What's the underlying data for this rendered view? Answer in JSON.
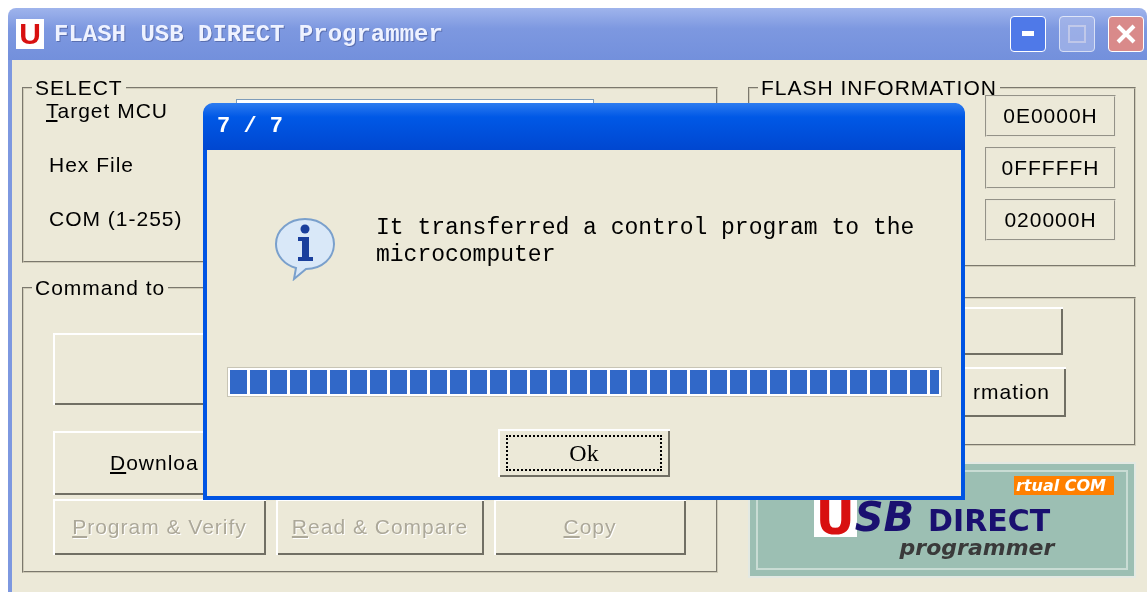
{
  "window": {
    "icon_letter": "U",
    "title": "FLASH USB DIRECT Programmer",
    "controls": [
      {
        "kind": "minimize",
        "disabled": false
      },
      {
        "kind": "maximize",
        "disabled": true
      },
      {
        "kind": "close",
        "disabled": false
      }
    ]
  },
  "select": {
    "legend": "SELECT",
    "rows": [
      {
        "label": "Target MCU",
        "mnemonic": true
      },
      {
        "label": "Hex File",
        "mnemonic": false
      },
      {
        "label": "COM (1-255)",
        "mnemonic": false
      }
    ]
  },
  "command": {
    "legend": "Command to",
    "buttons": [
      {
        "kind": "blank"
      },
      {
        "kind": "text",
        "label": "Downloa",
        "mnemonic": true
      }
    ],
    "bottom_buttons": [
      {
        "label": "Program & Verify",
        "mnemonic": true,
        "disabled": true
      },
      {
        "label": "Read & Compare",
        "mnemonic": true,
        "disabled": true
      },
      {
        "label": "Copy",
        "mnemonic": true,
        "disabled": true
      }
    ]
  },
  "flash_information": {
    "legend": "FLASH INFORMATION",
    "values": [
      "0E0000H",
      "0FFFFFH",
      "020000H"
    ]
  },
  "side_buttons": [
    {
      "kind": "blank"
    },
    {
      "kind": "text",
      "label": "rmation"
    }
  ],
  "logo": {
    "badge": "rtual COM",
    "letter": "U",
    "word": "SB",
    "direct": "DIRECT",
    "tagline": "programmer"
  },
  "dialog": {
    "title": "7 / 7",
    "message": "It transferred a control program to the microcomputer",
    "progress": {
      "level": 1
    },
    "button": "Ok"
  }
}
